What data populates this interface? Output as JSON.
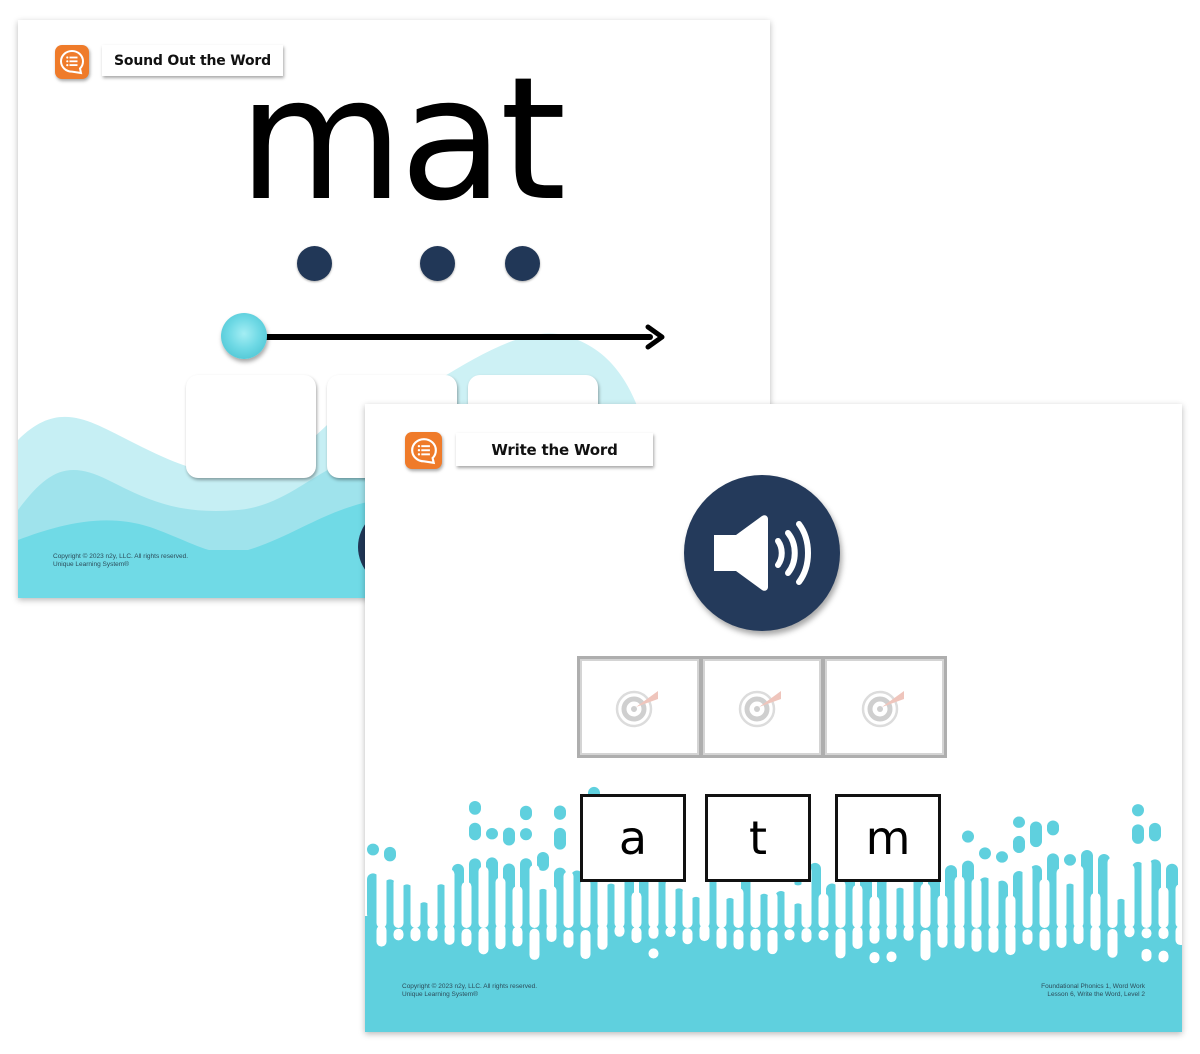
{
  "slides": [
    {
      "title": "Sound Out the Word",
      "menu_icon": "chat-list-icon",
      "word": "mat",
      "sound_dots": 3,
      "blend_slider": {
        "icon": "ball-handle",
        "direction": "right-arrow"
      },
      "answer_tiles": 3,
      "copyright": [
        "Copyright © 2023 n2y, LLC. All rights reserved.",
        "Unique Learning System®"
      ]
    },
    {
      "title": "Write the Word",
      "menu_icon": "chat-list-icon",
      "audio_icon": "speaker-icon",
      "drop_slots": [
        {
          "icon": "target-icon"
        },
        {
          "icon": "target-icon"
        },
        {
          "icon": "target-icon"
        }
      ],
      "letter_cards": [
        "a",
        "t",
        "m"
      ],
      "copyright": [
        "Copyright © 2023 n2y, LLC. All rights reserved.",
        "Unique Learning System®"
      ],
      "lesson_info": [
        "Foundational Phonics 1, Word Work",
        "Lesson 6, Write the Word, Level 2"
      ]
    }
  ],
  "colors": {
    "orange": "#ef7b2a",
    "navy": "#213757",
    "teal": "#5fd0de",
    "teal_light": "#a7e7ee"
  }
}
